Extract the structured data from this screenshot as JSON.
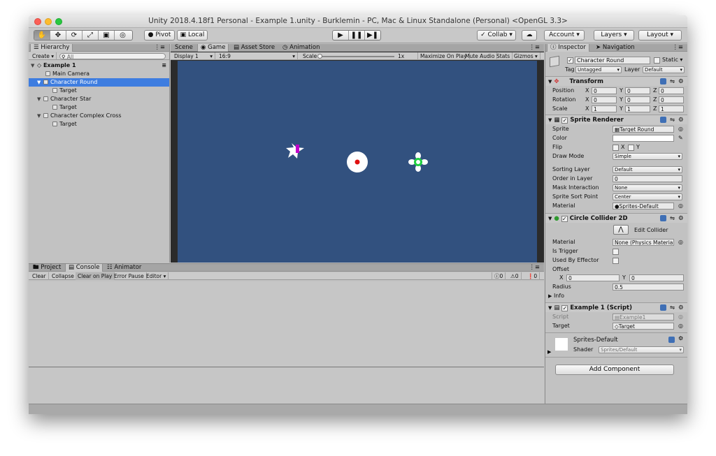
{
  "window": {
    "title": "Unity 2018.4.18f1 Personal - Example 1.unity - Burklemin - PC, Mac & Linux Standalone (Personal) <OpenGL 3.3>"
  },
  "toolbar": {
    "pivot": "Pivot",
    "local": "Local",
    "collab": "Collab",
    "account": "Account",
    "layers": "Layers",
    "layout": "Layout"
  },
  "hierarchy": {
    "tab": "Hierarchy",
    "create": "Create",
    "search_placeholder": "All",
    "scene": "Example 1",
    "items": [
      {
        "label": "Main Camera"
      },
      {
        "label": "Character Round"
      },
      {
        "label": "Target"
      },
      {
        "label": "Character Star"
      },
      {
        "label": "Target"
      },
      {
        "label": "Character Complex Cross"
      },
      {
        "label": "Target"
      }
    ]
  },
  "game": {
    "tabs": [
      "Scene",
      "Game",
      "Asset Store",
      "Animation"
    ],
    "display": "Display 1",
    "aspect": "16:9",
    "scale_label": "Scale",
    "scale_value": "1x",
    "maximize": "Maximize On Play",
    "mute": "Mute Audio",
    "stats": "Stats",
    "gizmos": "Gizmos",
    "bg_color": "#32517f"
  },
  "console": {
    "tabs": [
      "Project",
      "Console",
      "Animator"
    ],
    "clear": "Clear",
    "collapse": "Collapse",
    "clear_on_play": "Clear on Play",
    "error_pause": "Error Pause",
    "editor": "Editor",
    "counts": [
      "0",
      "0",
      "0"
    ]
  },
  "inspector": {
    "tabs": [
      "Inspector",
      "Navigation"
    ],
    "object_name": "Character Round",
    "static_label": "Static",
    "tag_label": "Tag",
    "tag_value": "Untagged",
    "layer_label": "Layer",
    "layer_value": "Default",
    "transform": {
      "title": "Transform",
      "position": "Position",
      "rotation": "Rotation",
      "scale": "Scale",
      "pos": [
        "0",
        "0",
        "0"
      ],
      "rot": [
        "0",
        "0",
        "0"
      ],
      "scl": [
        "1",
        "1",
        "1"
      ]
    },
    "sprite_renderer": {
      "title": "Sprite Renderer",
      "sprite_label": "Sprite",
      "sprite_value": "Target Round",
      "color_label": "Color",
      "flip_label": "Flip",
      "flip_x": "X",
      "flip_y": "Y",
      "draw_mode_label": "Draw Mode",
      "draw_mode_value": "Simple",
      "sorting_layer_label": "Sorting Layer",
      "sorting_layer_value": "Default",
      "order_label": "Order in Layer",
      "order_value": "0",
      "mask_label": "Mask Interaction",
      "mask_value": "None",
      "sort_point_label": "Sprite Sort Point",
      "sort_point_value": "Center",
      "material_label": "Material",
      "material_value": "Sprites-Default"
    },
    "circle_collider": {
      "title": "Circle Collider 2D",
      "edit_collider": "Edit Collider",
      "material_label": "Material",
      "material_value": "None (Physics Materia",
      "trigger_label": "Is Trigger",
      "effector_label": "Used By Effector",
      "offset_label": "Offset",
      "offset_x": "0",
      "offset_y": "0",
      "radius_label": "Radius",
      "radius_value": "0.5",
      "info_label": "Info"
    },
    "script": {
      "title": "Example 1 (Script)",
      "script_label": "Script",
      "script_value": "Example1",
      "target_label": "Target",
      "target_value": "Target"
    },
    "material": {
      "name": "Sprites-Default",
      "shader_label": "Shader",
      "shader_value": "Sprites/Default"
    },
    "add_component": "Add Component"
  }
}
